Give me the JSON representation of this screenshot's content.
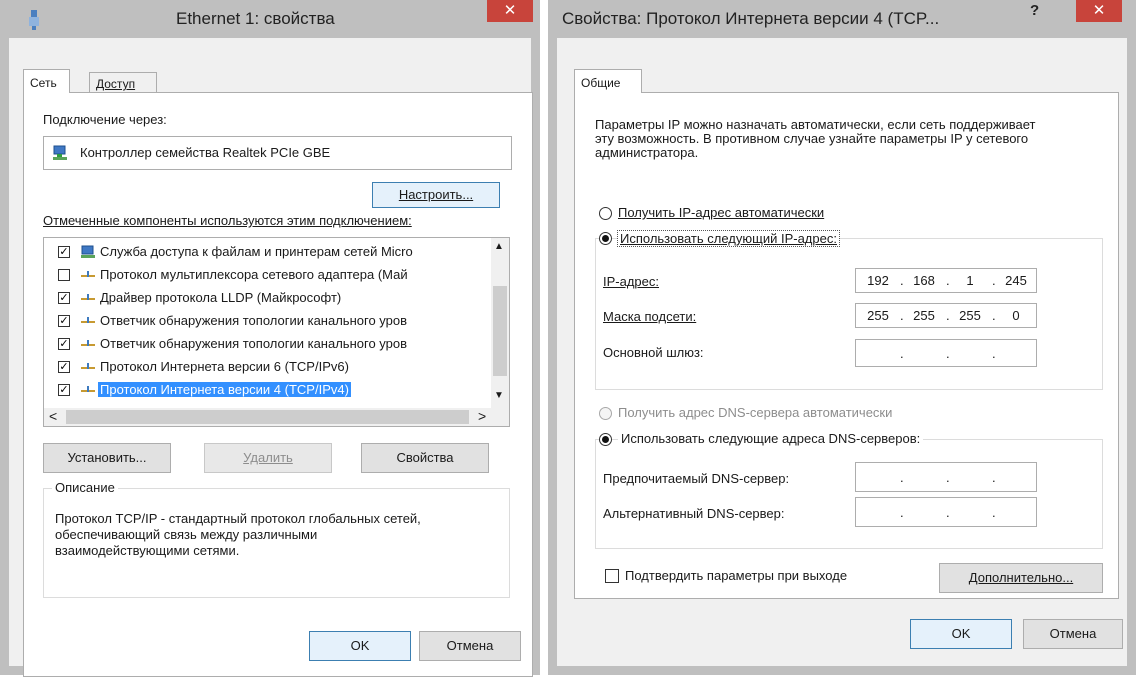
{
  "win1": {
    "title": "Ethernet 1: свойства",
    "close": "✕",
    "tabs": [
      "Сеть",
      "Доступ"
    ],
    "connect_via_label": "Подключение через:",
    "adapter_name": "Контроллер семейства Realtek PCIe GBE",
    "configure_button": "Настроить...",
    "components_label": "Отмеченные компоненты используются этим подключением:",
    "components": [
      {
        "checked": true,
        "label": "Служба доступа к файлам и принтерам сетей Micro"
      },
      {
        "checked": false,
        "label": "Протокол мультиплексора сетевого адаптера (Май"
      },
      {
        "checked": true,
        "label": "Драйвер протокола LLDP (Майкрософт)"
      },
      {
        "checked": true,
        "label": "Ответчик обнаружения топологии канального уров"
      },
      {
        "checked": true,
        "label": "Ответчик обнаружения топологии канального уров"
      },
      {
        "checked": true,
        "label": "Протокол Интернета версии 6 (TCP/IPv6)"
      },
      {
        "checked": true,
        "label": "Протокол Интернета версии 4 (TCP/IPv4)"
      }
    ],
    "install_button": "Установить...",
    "remove_button": "Удалить",
    "properties_button": "Свойства",
    "description_label": "Описание",
    "description_text": "Протокол TCP/IP - стандартный протокол глобальных сетей, обеспечивающий связь между различными взаимодействующими сетями.",
    "ok_button": "OK",
    "cancel_button": "Отмена"
  },
  "win2": {
    "title": "Свойства: Протокол Интернета версии 4 (TCP...",
    "help": "?",
    "close": "✕",
    "tab_general": "Общие",
    "intro_text": "Параметры IP можно назначать автоматически, если сеть поддерживает эту возможность. В противном случае узнайте параметры IP у сетевого администратора.",
    "ip_auto_label": "Получить IP-адрес автоматически",
    "ip_manual_label": "Использовать следующий IP-адрес:",
    "ip_label": "IP-адрес:",
    "ip_value": [
      "192",
      "168",
      "1",
      "245"
    ],
    "mask_label": "Маска подсети:",
    "mask_value": [
      "255",
      "255",
      "255",
      "0"
    ],
    "gateway_label": "Основной шлюз:",
    "dns_auto_label": "Получить адрес DNS-сервера автоматически",
    "dns_manual_label": "Использовать следующие адреса DNS-серверов:",
    "dns_pref_label": "Предпочитаемый DNS-сервер:",
    "dns_alt_label": "Альтернативный DNS-сервер:",
    "validate_label": "Подтвердить параметры при выходе",
    "advanced_button": "Дополнительно...",
    "ok_button": "OK",
    "cancel_button": "Отмена"
  },
  "ip_dot": "."
}
